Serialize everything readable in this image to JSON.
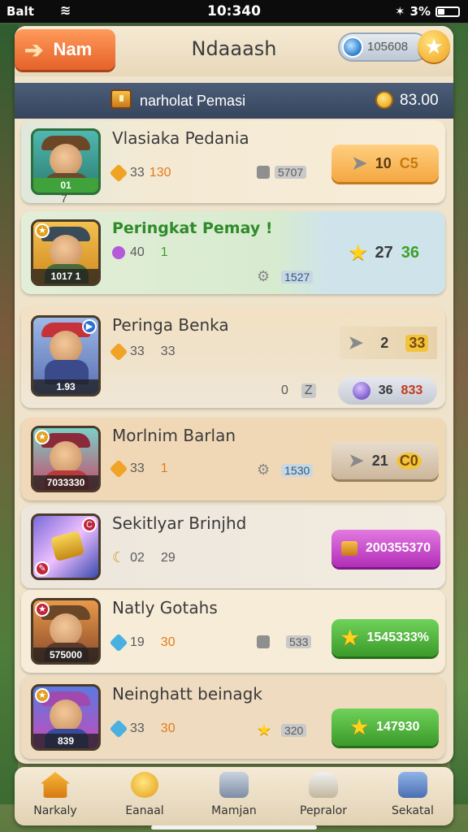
{
  "status_bar": {
    "carrier": "Balt",
    "time": "10:340",
    "battery": "3%",
    "battery_level": 0.3
  },
  "topbar": {
    "back_label": "Nam",
    "title": "Ndaaash",
    "gem_value": "105608"
  },
  "header": {
    "title": "narholat Pemasi",
    "coins": "83.00"
  },
  "rows": [
    {
      "name": "Vlasiaka Pedania",
      "avatar_caption": "01",
      "avatar_num": "7",
      "stat1": "33",
      "stat2": "130",
      "stat3": "5707",
      "reward": "10",
      "reward_suffix": "C5"
    },
    {
      "name": "Peringkat Pemay !",
      "avatar_caption": "1017  1",
      "stat1": "40",
      "stat2": "1",
      "stat3": "1527",
      "reward": "27",
      "reward_suffix": "36"
    },
    {
      "name": "Peringa Benka",
      "avatar_caption": "1.93",
      "stat1": "33",
      "stat2": "33",
      "reward": "2",
      "reward_suffix": "33",
      "stat3": "0",
      "stat4": "Z",
      "reward2": "36",
      "reward2_suffix": "833"
    },
    {
      "name": "Morlnim Barlan",
      "avatar_caption": "7033330",
      "stat1": "33",
      "stat2": "1",
      "stat3": "1530",
      "reward": "21",
      "reward_suffix": "C0"
    },
    {
      "name": "Sekitlyar Brinjhd",
      "stat1": "02",
      "stat2": "29",
      "reward": "200355370"
    },
    {
      "name": "Natly Gotahs",
      "avatar_caption": "575000",
      "stat1": "19",
      "stat2": "30",
      "stat3": "533",
      "reward": "1545333%"
    },
    {
      "name": "Neinghatt beinagk",
      "avatar_caption": "839",
      "stat1": "33",
      "stat2": "30",
      "stat3": "320",
      "reward": "147930"
    }
  ],
  "nav": [
    "Narkaly",
    "Eanaal",
    "Mamjan",
    "Pepralor",
    "Sekatal"
  ],
  "colors": {
    "accent": "#e5622a",
    "green": "#4caf2e",
    "purple": "#c13bc9",
    "header": "#3e4e68"
  }
}
